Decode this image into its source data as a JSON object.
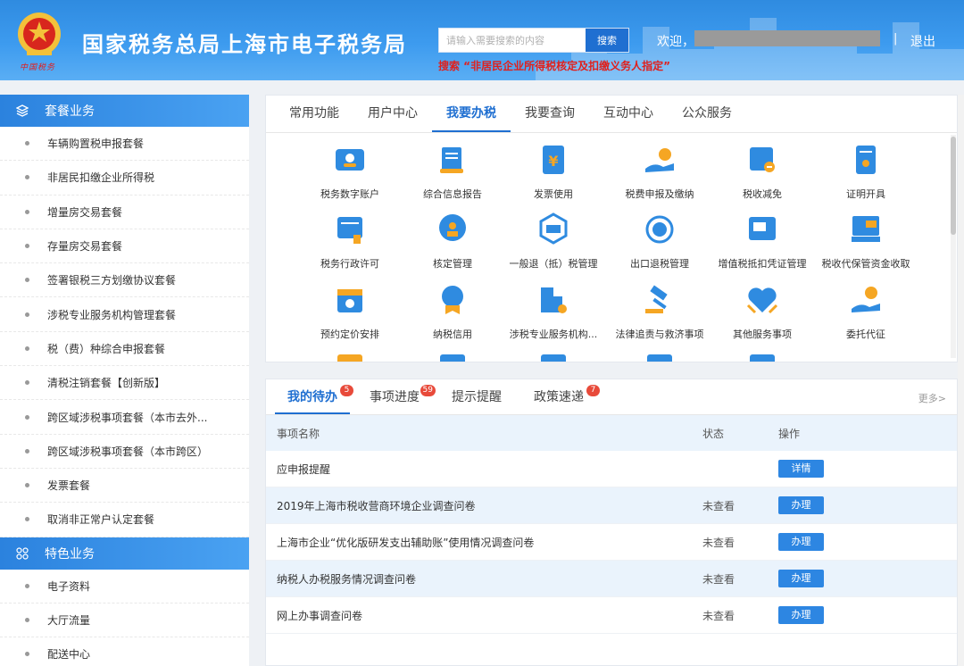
{
  "header": {
    "title": "国家税务总局上海市电子税务局",
    "emblem_caption": "中国税务",
    "search_placeholder": "请输入需要搜索的内容",
    "search_button": "搜索",
    "search_hint": "搜索 “非居民企业所得税核定及扣缴义务人指定”",
    "welcome": "欢迎，",
    "separator": "|",
    "logout": "退出"
  },
  "sidebar": {
    "section1": "套餐业务",
    "items1": [
      "车辆购置税申报套餐",
      "非居民扣缴企业所得税",
      "增量房交易套餐",
      "存量房交易套餐",
      "签署银税三方划缴协议套餐",
      "涉税专业服务机构管理套餐",
      "税（费）种综合申报套餐",
      "清税注销套餐【创新版】",
      "跨区域涉税事项套餐（本市去外...",
      "跨区域涉税事项套餐（本市跨区）",
      "发票套餐",
      "取消非正常户认定套餐"
    ],
    "section2": "特色业务",
    "items2": [
      "电子资料",
      "大厅流量",
      "配送中心"
    ]
  },
  "main_tabs": [
    "常用功能",
    "用户中心",
    "我要办税",
    "我要查询",
    "互动中心",
    "公众服务"
  ],
  "functions": [
    {
      "label": "税务数字账户",
      "icon": "digital-account-icon"
    },
    {
      "label": "综合信息报告",
      "icon": "info-report-icon"
    },
    {
      "label": "发票使用",
      "icon": "invoice-icon"
    },
    {
      "label": "税费申报及缴纳",
      "icon": "tax-payment-icon"
    },
    {
      "label": "税收减免",
      "icon": "tax-relief-icon"
    },
    {
      "label": "证明开具",
      "icon": "certificate-icon"
    },
    {
      "label": "税务行政许可",
      "icon": "admin-license-icon"
    },
    {
      "label": "核定管理",
      "icon": "verification-icon"
    },
    {
      "label": "一般退（抵）税管理",
      "icon": "tax-refund-icon"
    },
    {
      "label": "出口退税管理",
      "icon": "export-refund-icon"
    },
    {
      "label": "增值税抵扣凭证管理",
      "icon": "vat-voucher-icon"
    },
    {
      "label": "税收代保管资金收取",
      "icon": "custody-fund-icon"
    },
    {
      "label": "预约定价安排",
      "icon": "pricing-calendar-icon"
    },
    {
      "label": "纳税信用",
      "icon": "credit-icon"
    },
    {
      "label": "涉税专业服务机构...",
      "icon": "agency-icon"
    },
    {
      "label": "法律追责与救济事项",
      "icon": "legal-hammer-icon"
    },
    {
      "label": "其他服务事项",
      "icon": "other-service-icon"
    },
    {
      "label": "委托代征",
      "icon": "entrusted-collection-icon"
    }
  ],
  "todo_tabs": [
    {
      "label": "我的待办",
      "badge": "5"
    },
    {
      "label": "事项进度",
      "badge": "59"
    },
    {
      "label": "提示提醒",
      "badge": ""
    },
    {
      "label": "政策速递",
      "badge": "7"
    }
  ],
  "more": "更多>",
  "table": {
    "headers": [
      "事项名称",
      "状态",
      "操作"
    ],
    "rows": [
      {
        "name": "应申报提醒",
        "status": "",
        "action": "详情"
      },
      {
        "name": "2019年上海市税收营商环境企业调查问卷",
        "status": "未查看",
        "action": "办理"
      },
      {
        "name": "上海市企业“优化版研发支出辅助账”使用情况调查问卷",
        "status": "未查看",
        "action": "办理"
      },
      {
        "name": "纳税人办税服务情况调查问卷",
        "status": "未查看",
        "action": "办理"
      },
      {
        "name": "网上办事调查问卷",
        "status": "未查看",
        "action": "办理"
      }
    ]
  },
  "colors": {
    "primary": "#1f6fd1",
    "header": "#3d9bef",
    "hint": "#e0201c",
    "badge": "#e84a3a",
    "icon_blue": "#2f8be0",
    "icon_orange": "#f5a623"
  }
}
